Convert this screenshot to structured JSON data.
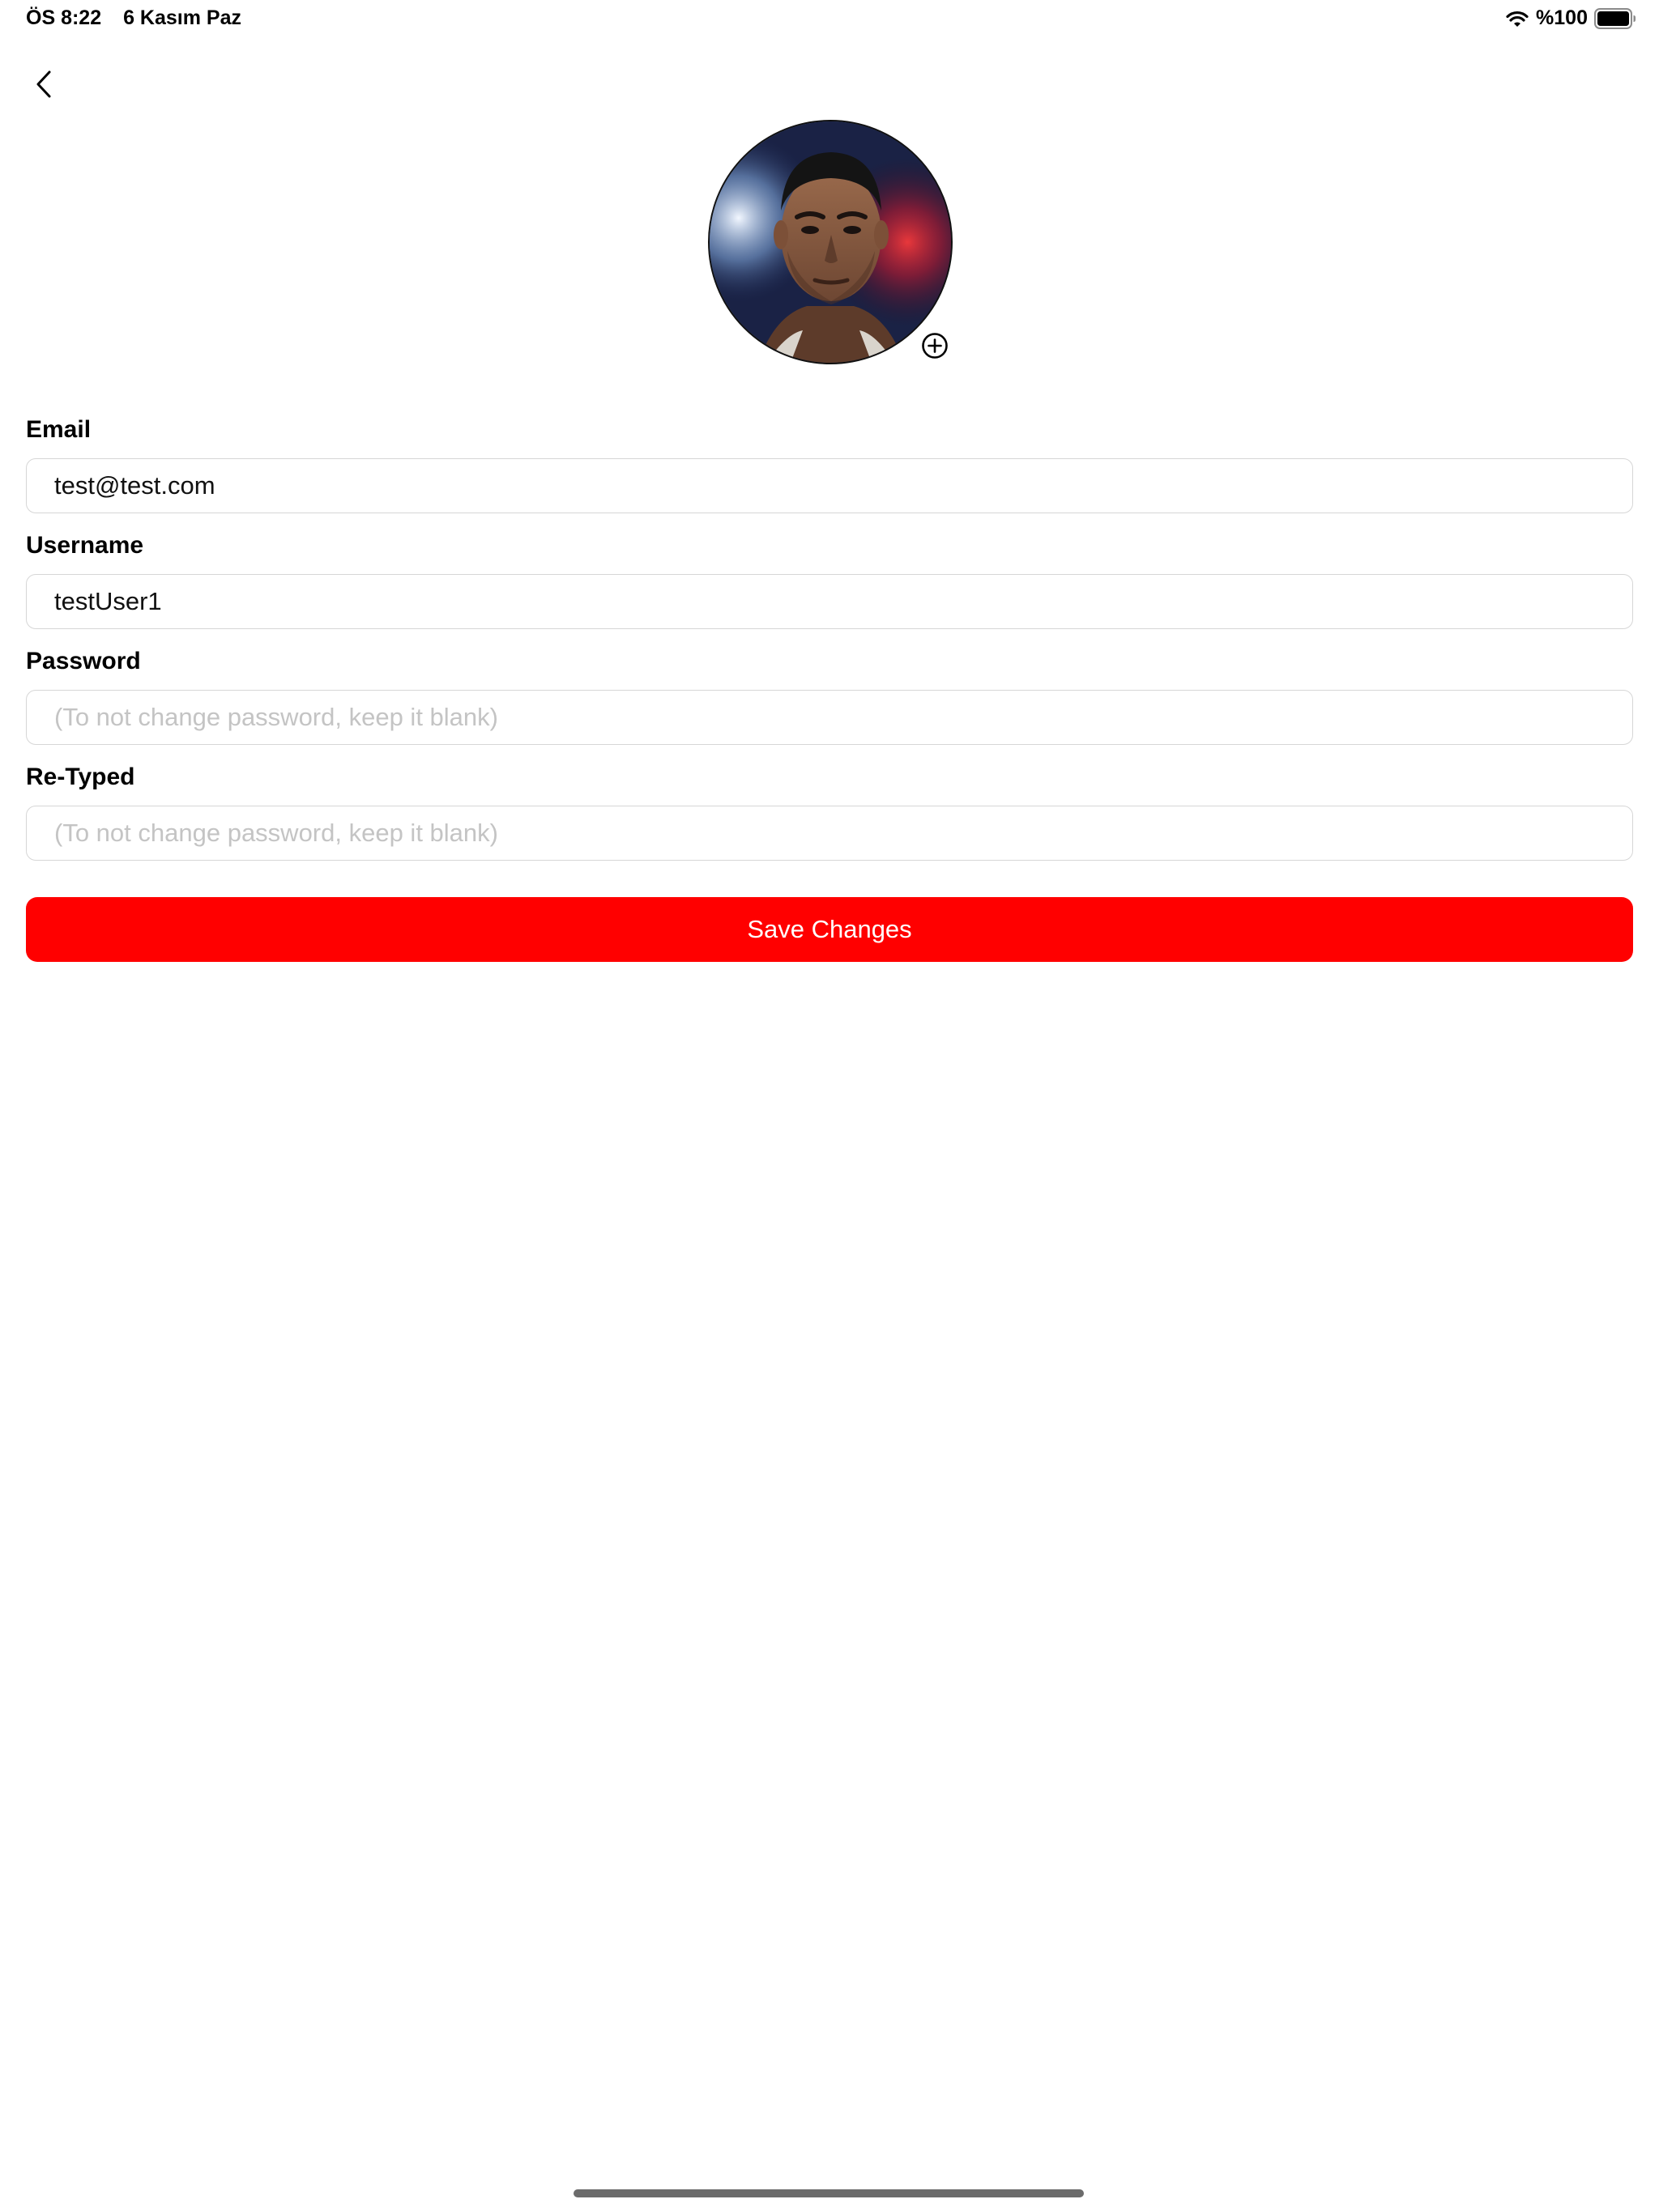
{
  "status_bar": {
    "time": "ÖS 8:22",
    "date": "6 Kasım Paz",
    "battery_text": "%100",
    "battery_level": 1.0
  },
  "header": {
    "back_icon": "chevron-left-icon"
  },
  "avatar": {
    "add_icon": "plus-circle-icon"
  },
  "form": {
    "email": {
      "label": "Email",
      "value": "test@test.com",
      "placeholder": ""
    },
    "username": {
      "label": "Username",
      "value": "testUser1",
      "placeholder": ""
    },
    "password": {
      "label": "Password",
      "value": "",
      "placeholder": "(To not change password, keep it blank)"
    },
    "retyped": {
      "label": "Re-Typed",
      "value": "",
      "placeholder": "(To not change password, keep it blank)"
    }
  },
  "save_button": {
    "label": "Save Changes",
    "color": "#ff0000"
  }
}
